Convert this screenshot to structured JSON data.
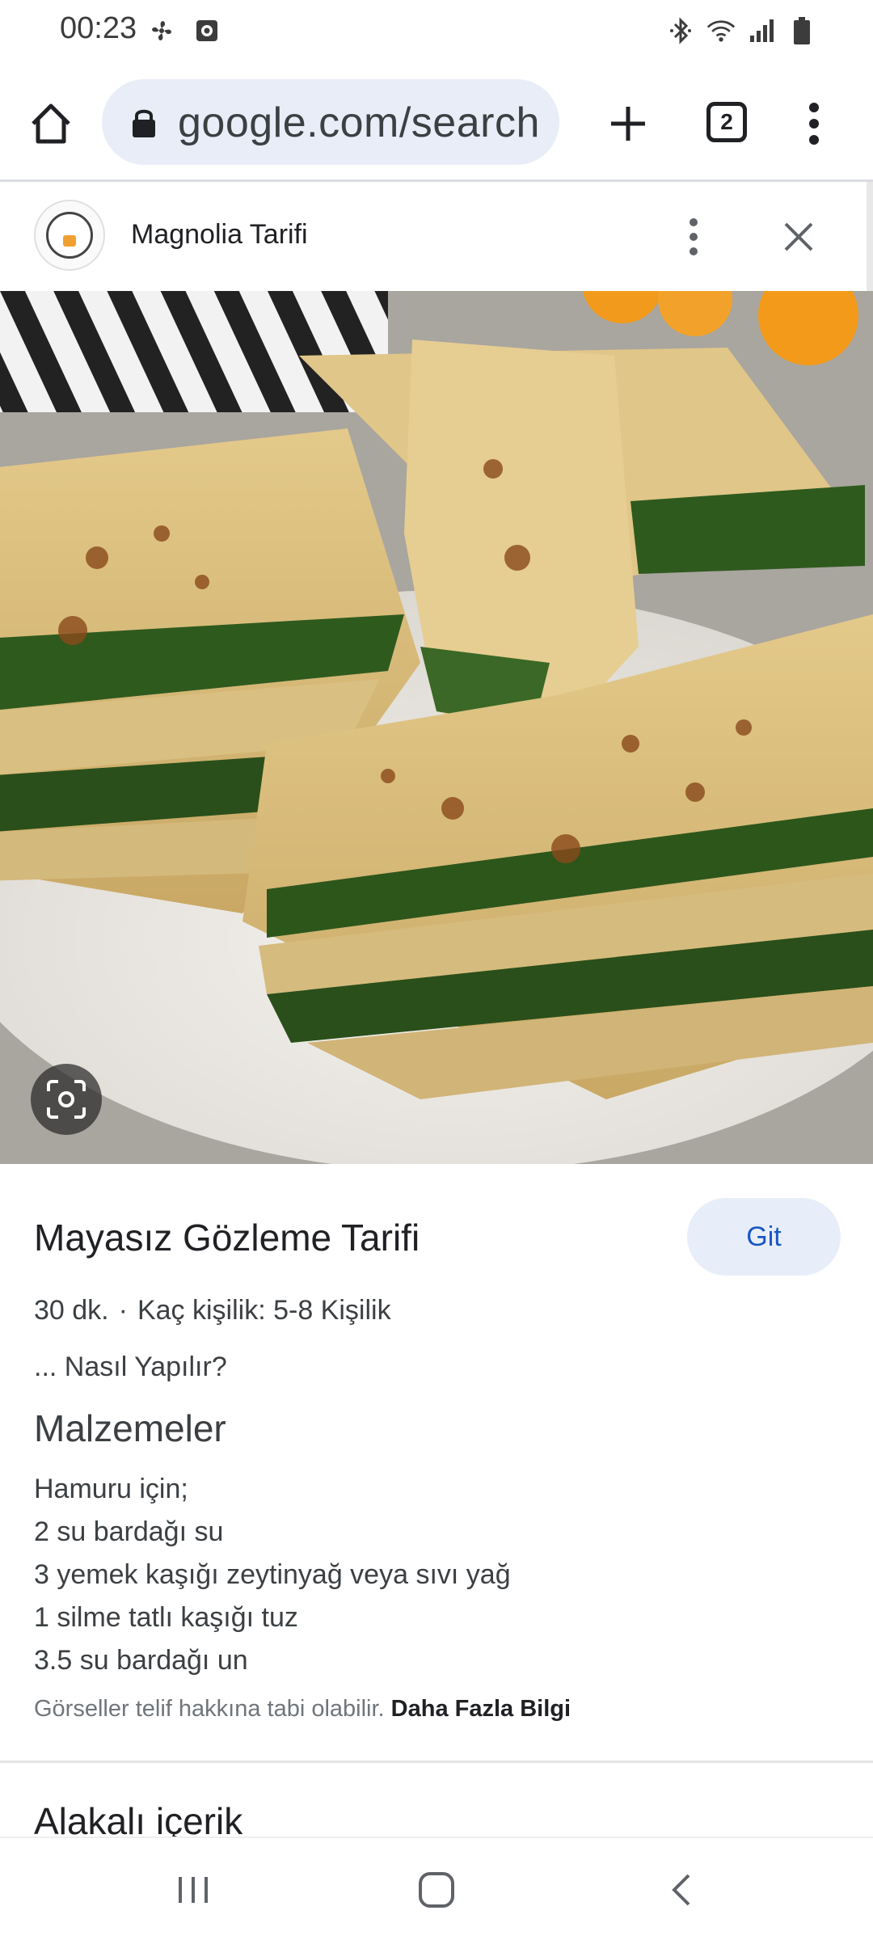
{
  "status_bar": {
    "time": "00:23",
    "left_icons": [
      "pinwheel-icon",
      "screen-record-icon"
    ],
    "right_icons": [
      "bluetooth-icon",
      "wifi-icon",
      "signal-icon",
      "battery-icon"
    ]
  },
  "browser": {
    "url": "google.com/search",
    "tab_count": "2",
    "icons": [
      "home-icon",
      "lock-icon",
      "plus-icon",
      "tabs-icon",
      "more-vert-icon"
    ]
  },
  "source": {
    "name": "Magnolia Tarifi"
  },
  "result": {
    "title": "Mayasız Gözleme Tarifi",
    "go_label": "Git",
    "time": "30 dk.",
    "separator": "·",
    "servings": "Kaç kişilik: 5-8 Kişilik",
    "subline": "... Nasıl Yapılır?",
    "section_title": "Malzemeler",
    "ingredients": [
      "Hamuru için;",
      "2 su bardağı su",
      "3 yemek kaşığı zeytinyağ veya sıvı yağ",
      "1 silme tatlı kaşığı tuz",
      "3.5 su bardağı un"
    ],
    "copyright_text": "Görseller telif hakkına tabi olabilir.",
    "learn_more": "Daha Fazla Bilgi",
    "related_heading": "Alakalı içerik"
  },
  "navbar": {
    "icons": [
      "recents-icon",
      "home-nav-icon",
      "back-icon"
    ]
  }
}
